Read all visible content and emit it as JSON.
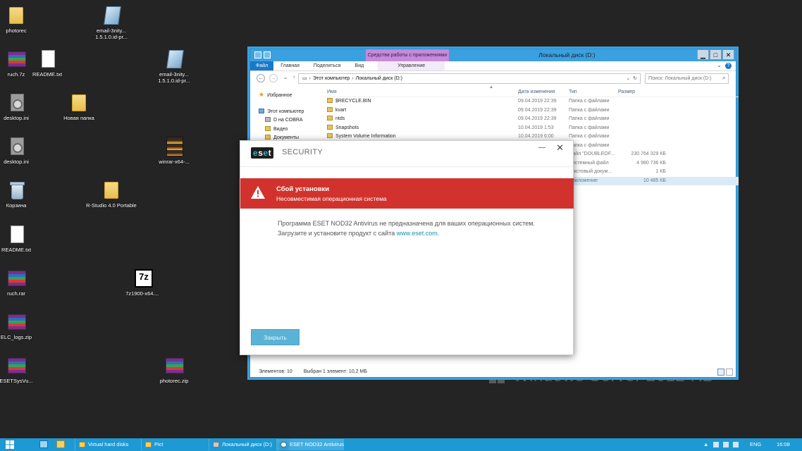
{
  "desktop": {
    "icons": [
      {
        "label": "photorec"
      },
      {
        "label": "email-3nity... 1.5.1.0.id-pr..."
      },
      {
        "label": "ruch.7z"
      },
      {
        "label": "README.txt"
      },
      {
        "label": "email-3nity... 1.5.1.0.id-pr..."
      },
      {
        "label": "desktop.ini"
      },
      {
        "label": "Новая папка"
      },
      {
        "label": "desktop.ini"
      },
      {
        "label": "winrar-x64-..."
      },
      {
        "label": "Корзина"
      },
      {
        "label": "R-Studio 4.0 Portable"
      },
      {
        "label": "README.txt"
      },
      {
        "label": "ruch.rar"
      },
      {
        "label": "7z1900-x64...."
      },
      {
        "label": "ELC_logs.zip"
      },
      {
        "label": "ESETSysVu..."
      },
      {
        "label": "photorec.zip"
      }
    ],
    "watermark": "Windows Server 2012 R2"
  },
  "explorer": {
    "title": "Локальный диск (D:)",
    "contextual_tab": "Средства работы с приложениями",
    "ribbon_tabs": {
      "file": "Файл",
      "home": "Главная",
      "share": "Поделиться",
      "view": "Вид",
      "manage": "Управление"
    },
    "address": {
      "part1": "Этот компьютер",
      "part2": "Локальный диск (D:)"
    },
    "search_placeholder": "Поиск: Локальный диск (D:)",
    "nav": {
      "favorites": "Избранное",
      "this_pc": "Этот компьютер",
      "drive": "D на COBRA",
      "video": "Видео",
      "documents": "Документы"
    },
    "columns": {
      "name": "Имя",
      "date": "Дата изменения",
      "type": "Тип",
      "size": "Размер"
    },
    "rows": [
      {
        "name": "$RECYCLE.BIN",
        "date": "09.04.2019 22:39",
        "type": "Папка с файлами",
        "size": ""
      },
      {
        "name": "kvart",
        "date": "09.04.2019 22:39",
        "type": "Папка с файлами",
        "size": ""
      },
      {
        "name": "ntds",
        "date": "09.04.2019 22:39",
        "type": "Папка с файлами",
        "size": ""
      },
      {
        "name": "Snapshots",
        "date": "10.04.2019 1:53",
        "type": "Папка с файлами",
        "size": ""
      },
      {
        "name": "System Volume Information",
        "date": "10.04.2019 6:00",
        "type": "Папка с файлами",
        "size": ""
      },
      {
        "name": "",
        "date": "",
        "type": "Папка с файлами",
        "size": ""
      },
      {
        "name": "",
        "date": "",
        "type": "Файл \"DOUBLEOF...",
        "size": "230 764 329 КБ"
      },
      {
        "name": "",
        "date": "",
        "type": "Системный файл",
        "size": "4 980 736 КБ"
      },
      {
        "name": "",
        "date": "",
        "type": "Текстовый докум...",
        "size": "1 КБ"
      },
      {
        "name": "",
        "date": "",
        "type": "Приложение",
        "size": "10 485 КБ"
      }
    ],
    "status": {
      "items": "Элементов: 10",
      "selected": "Выбран 1 элемент: 10,2 МБ"
    }
  },
  "eset": {
    "logo": "eset",
    "product": "SECURITY",
    "alert_title": "Сбой установки",
    "alert_subtitle": "Несовместимая операционная система",
    "message_line1": "Программа ESET NOD32 Antivirus не предназначена для ваших операционных систем.",
    "message_line2_prefix": "Загрузите и установите продукт с сайта",
    "message_link": "www.eset.com",
    "message_suffix": ".",
    "close_button": "Закрыть",
    "colors": {
      "alert": "#d2322d",
      "button": "#5ab3d6",
      "link": "#1a8fb0"
    }
  },
  "taskbar": {
    "tasks": [
      {
        "label": "Virtual hard disks"
      },
      {
        "label": "Pict"
      },
      {
        "label": "Локальный диск (D:)"
      },
      {
        "label": "ESET NOD32 Antivirus"
      }
    ],
    "language": "ENG",
    "time": "16:08",
    "color": "#1d99d4"
  }
}
